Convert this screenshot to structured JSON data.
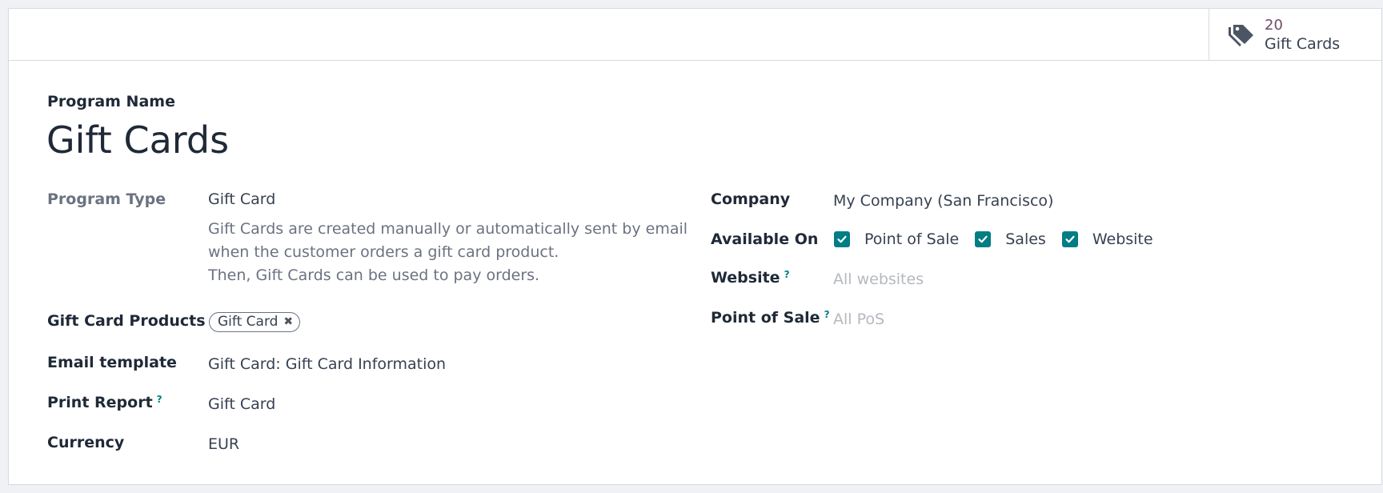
{
  "smart_button": {
    "count": "20",
    "label": "Gift Cards",
    "icon": "tags-icon",
    "count_color": "#714b67"
  },
  "header": {
    "title_label": "Program Name",
    "title": "Gift Cards"
  },
  "left_fields": {
    "program_type": {
      "label": "Program Type",
      "value": "Gift Card",
      "description": [
        "Gift Cards are created manually or automatically sent by email",
        "when the customer orders a gift card product.",
        "Then, Gift Cards can be used to pay orders."
      ]
    },
    "products": {
      "label": "Gift Card Products",
      "tags": [
        "Gift Card"
      ]
    },
    "email_template": {
      "label": "Email template",
      "value": "Gift Card: Gift Card Information"
    },
    "print_report": {
      "label": "Print Report",
      "help": "?",
      "value": "Gift Card"
    },
    "currency": {
      "label": "Currency",
      "value": "EUR"
    }
  },
  "right_fields": {
    "company": {
      "label": "Company",
      "value": "My Company (San Francisco)"
    },
    "available_on": {
      "label": "Available On",
      "options": [
        {
          "label": "Point of Sale",
          "checked": true
        },
        {
          "label": "Sales",
          "checked": true
        },
        {
          "label": "Website",
          "checked": true
        }
      ]
    },
    "website": {
      "label": "Website",
      "help": "?",
      "placeholder": "All websites"
    },
    "point_of_sale": {
      "label": "Point of Sale",
      "help": "?",
      "placeholder": "All PoS"
    }
  },
  "colors": {
    "accent": "#017e84",
    "brand": "#714b67"
  }
}
